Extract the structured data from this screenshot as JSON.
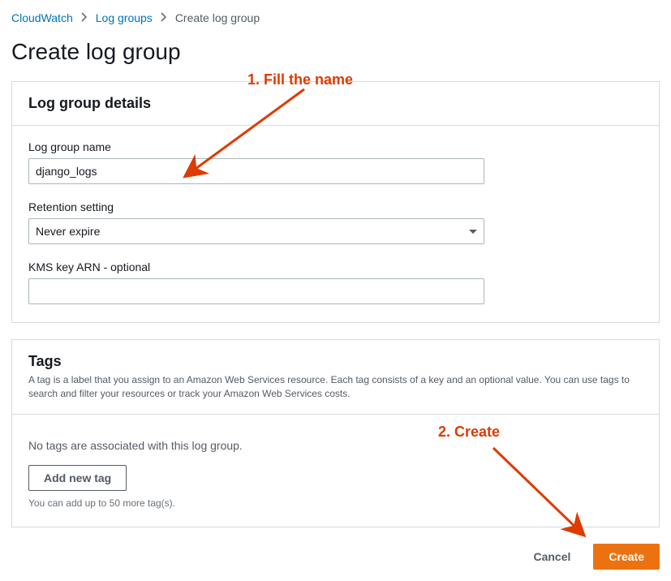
{
  "breadcrumb": {
    "service": "CloudWatch",
    "section": "Log groups",
    "current": "Create log group"
  },
  "page_title": "Create log group",
  "details_panel": {
    "title": "Log group details",
    "name_label": "Log group name",
    "name_value": "django_logs",
    "retention_label": "Retention setting",
    "retention_value": "Never expire",
    "kms_label": "KMS key ARN - optional",
    "kms_value": ""
  },
  "tags_panel": {
    "title": "Tags",
    "desc": "A tag is a label that you assign to an Amazon Web Services resource. Each tag consists of a key and an optional value. You can use tags to search and filter your resources or track your Amazon Web Services costs.",
    "empty": "No tags are associated with this log group.",
    "add_btn": "Add new tag",
    "hint": "You can add up to 50 more tag(s)."
  },
  "actions": {
    "cancel": "Cancel",
    "create": "Create"
  },
  "annotations": {
    "step1": "1. Fill the name",
    "step2": "2. Create"
  }
}
